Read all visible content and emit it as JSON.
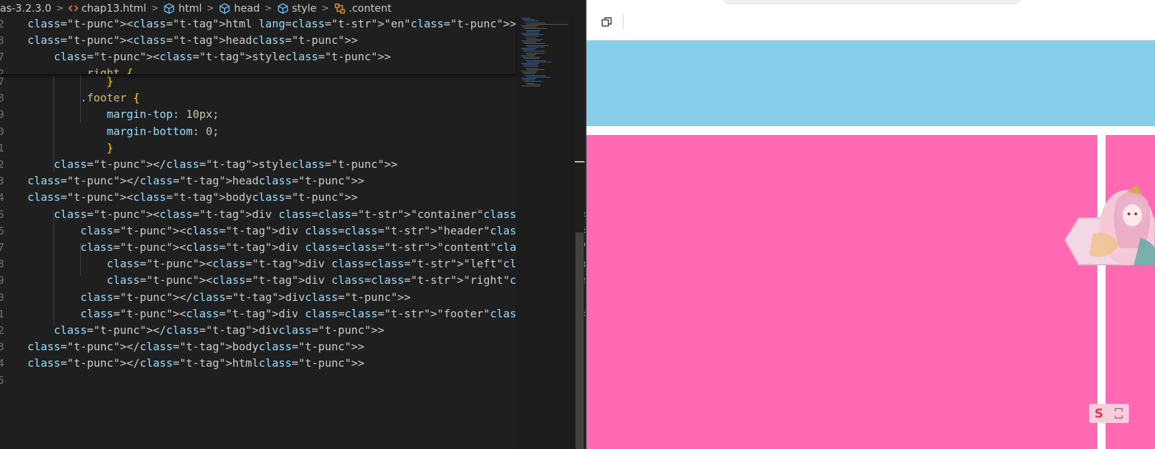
{
  "breadcrumb": [
    {
      "label": "as-3.2.3.0",
      "icon": ""
    },
    {
      "label": "chap13.html",
      "icon": "html-file-icon"
    },
    {
      "label": "html",
      "icon": "element-cube-icon"
    },
    {
      "label": "head",
      "icon": "element-cube-icon"
    },
    {
      "label": "style",
      "icon": "element-cube-icon"
    },
    {
      "label": ".content",
      "icon": "css-selector-icon"
    }
  ],
  "sticky_lines": [
    {
      "num": "2",
      "text": "<html lang=\"en\">"
    },
    {
      "num": "3",
      "text": "<head>"
    },
    {
      "num": "7",
      "text": "    <style>"
    },
    {
      "num": "2",
      "text": "        .right {"
    }
  ],
  "code_lines": [
    {
      "num": "7",
      "text": "            }"
    },
    {
      "num": "8",
      "text": "        .footer {"
    },
    {
      "num": "9",
      "text": "            margin-top: 10px;"
    },
    {
      "num": "0",
      "text": "            margin-bottom: 0;"
    },
    {
      "num": "1",
      "text": "            }"
    },
    {
      "num": "2",
      "text": "    </style>"
    },
    {
      "num": "3",
      "text": "</head>"
    },
    {
      "num": "4",
      "text": "<body>"
    },
    {
      "num": "5",
      "text": "    <div class=\"container\">"
    },
    {
      "num": "6",
      "text": "        <div class=\"header\"></div>"
    },
    {
      "num": "7",
      "text": "        <div class=\"content\">"
    },
    {
      "num": "8",
      "text": "            <div class=\"left\"></div>"
    },
    {
      "num": "9",
      "text": "            <div class=\"right\"></div>"
    },
    {
      "num": "0",
      "text": "        </div>"
    },
    {
      "num": "1",
      "text": "        <div class=\"footer\"></div>"
    },
    {
      "num": "2",
      "text": "    </div>"
    },
    {
      "num": "3",
      "text": "</body>"
    },
    {
      "num": "4",
      "text": "</html>"
    },
    {
      "num": "5",
      "text": ""
    }
  ],
  "preview": {
    "header_color": "#87ceeb",
    "content_color": "#ff69b4",
    "ime_label": "S"
  },
  "colors": {
    "editor_bg": "#1f1f1f",
    "tag": "#569cd6",
    "attribute": "#9cdcfe",
    "string": "#ce9178",
    "selector": "#d7ba7d",
    "brace": "#ffd700",
    "number": "#b5cea8"
  }
}
